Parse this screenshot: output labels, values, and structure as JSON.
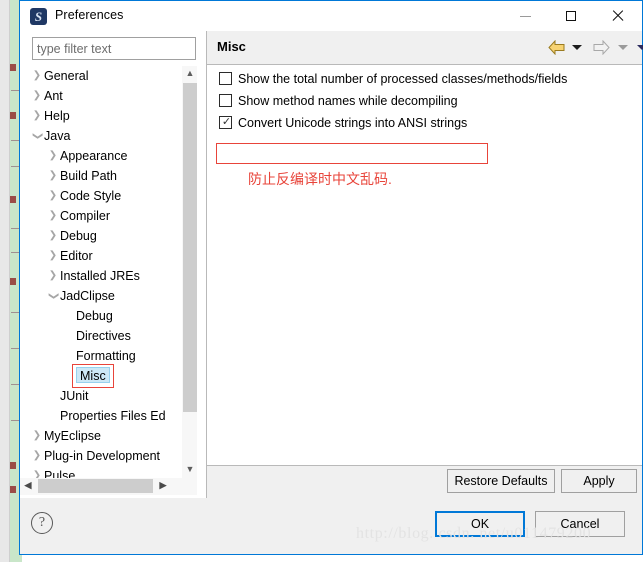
{
  "window": {
    "title": "Preferences",
    "icon": "myeclipse-icon",
    "controls": {
      "minimize": "minimize-icon",
      "maximize": "maximize-icon",
      "close": "close-icon"
    }
  },
  "filter": {
    "placeholder": "type filter text",
    "value": ""
  },
  "tree": {
    "items": [
      {
        "label": "General",
        "indent": 0,
        "twisty": "collapsed",
        "selected": false
      },
      {
        "label": "Ant",
        "indent": 0,
        "twisty": "collapsed",
        "selected": false
      },
      {
        "label": "Help",
        "indent": 0,
        "twisty": "collapsed",
        "selected": false
      },
      {
        "label": "Java",
        "indent": 0,
        "twisty": "expanded",
        "selected": false
      },
      {
        "label": "Appearance",
        "indent": 1,
        "twisty": "collapsed",
        "selected": false
      },
      {
        "label": "Build Path",
        "indent": 1,
        "twisty": "collapsed",
        "selected": false
      },
      {
        "label": "Code Style",
        "indent": 1,
        "twisty": "collapsed",
        "selected": false
      },
      {
        "label": "Compiler",
        "indent": 1,
        "twisty": "collapsed",
        "selected": false
      },
      {
        "label": "Debug",
        "indent": 1,
        "twisty": "collapsed",
        "selected": false
      },
      {
        "label": "Editor",
        "indent": 1,
        "twisty": "collapsed",
        "selected": false
      },
      {
        "label": "Installed JREs",
        "indent": 1,
        "twisty": "collapsed",
        "selected": false
      },
      {
        "label": "JadClipse",
        "indent": 1,
        "twisty": "expanded",
        "selected": false
      },
      {
        "label": "Debug",
        "indent": 2,
        "twisty": "none",
        "selected": false
      },
      {
        "label": "Directives",
        "indent": 2,
        "twisty": "none",
        "selected": false
      },
      {
        "label": "Formatting",
        "indent": 2,
        "twisty": "none",
        "selected": false
      },
      {
        "label": "Misc",
        "indent": 2,
        "twisty": "none",
        "selected": true
      },
      {
        "label": "JUnit",
        "indent": 1,
        "twisty": "none",
        "selected": false
      },
      {
        "label": "Properties Files Ed",
        "indent": 1,
        "twisty": "none",
        "selected": false
      },
      {
        "label": "MyEclipse",
        "indent": 0,
        "twisty": "collapsed",
        "selected": false
      },
      {
        "label": "Plug-in Development",
        "indent": 0,
        "twisty": "collapsed",
        "selected": false
      },
      {
        "label": "Pulse",
        "indent": 0,
        "twisty": "collapsed",
        "selected": false
      }
    ],
    "scroll": {
      "up_arrow": "chevron-up-icon",
      "down_arrow": "chevron-down-icon",
      "left_arrow": "chevron-left-icon",
      "right_arrow": "chevron-right-icon"
    }
  },
  "panel": {
    "title": "Misc",
    "nav": {
      "back": "back-arrow-icon",
      "back_menu": "chevron-down-icon",
      "forward": "forward-arrow-icon",
      "forward_menu": "chevron-down-icon",
      "view_menu": "chevron-down-icon"
    },
    "checkboxes": [
      {
        "label": "Show the total number of processed classes/methods/fields",
        "checked": false
      },
      {
        "label": "Show method names while decompiling",
        "checked": false
      },
      {
        "label": "Convert Unicode strings into ANSI strings",
        "checked": true
      }
    ],
    "annotation": {
      "text": "防止反编译时中文乱码.",
      "color": "#e8443a"
    },
    "buttons": {
      "restore_defaults": "Restore Defaults",
      "apply": "Apply"
    }
  },
  "footer": {
    "help": "?",
    "ok": "OK",
    "cancel": "Cancel"
  },
  "watermark": "http://blog. csdn. net/u011479200",
  "colors": {
    "accent": "#0078d7",
    "selection": "#cde8f6",
    "annotation": "#e8443a",
    "title_icon": "#1f3864"
  }
}
